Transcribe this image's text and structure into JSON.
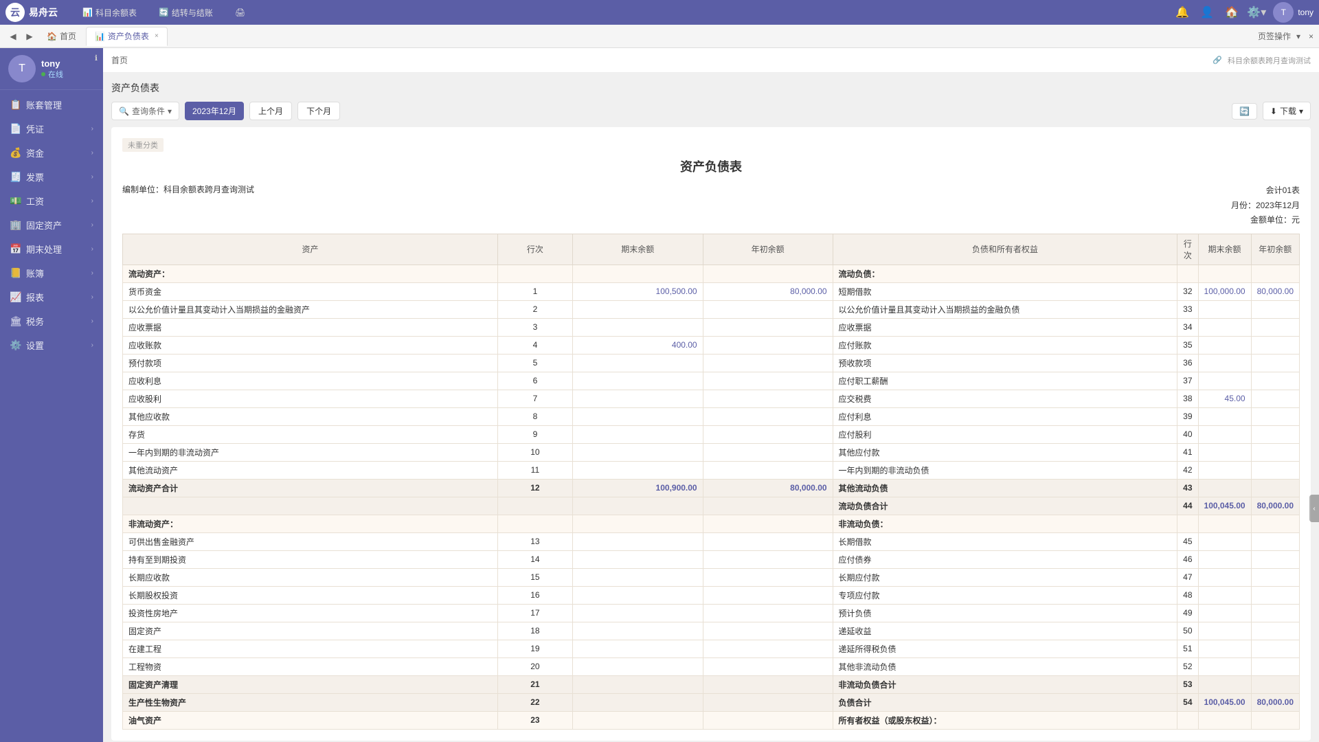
{
  "topbar": {
    "logo_text": "易舟云",
    "logo_icon": "云",
    "menus": [
      {
        "label": "科目余额表",
        "icon": "📊"
      },
      {
        "label": "结转与结账",
        "icon": "🔄"
      },
      {
        "label": "打印",
        "icon": "🖨"
      }
    ],
    "user": "tony",
    "icons": [
      "🔔",
      "👤",
      "🏠",
      "⚙️"
    ]
  },
  "tabs": {
    "home": "首页",
    "active_tab": "资产负债表",
    "tab_close": "×",
    "more_label": "页签操作",
    "close_all": "×"
  },
  "sidebar": {
    "user_name": "tony",
    "user_status": "在线",
    "items": [
      {
        "label": "账套管理",
        "icon": "📋",
        "has_arrow": false
      },
      {
        "label": "凭证",
        "icon": "📄",
        "has_arrow": true
      },
      {
        "label": "资金",
        "icon": "💰",
        "has_arrow": true
      },
      {
        "label": "发票",
        "icon": "🧾",
        "has_arrow": true
      },
      {
        "label": "工资",
        "icon": "💵",
        "has_arrow": true
      },
      {
        "label": "固定资产",
        "icon": "🏢",
        "has_arrow": true
      },
      {
        "label": "期末处理",
        "icon": "📅",
        "has_arrow": true
      },
      {
        "label": "账簿",
        "icon": "📒",
        "has_arrow": true
      },
      {
        "label": "报表",
        "icon": "📈",
        "has_arrow": true
      },
      {
        "label": "税务",
        "icon": "🏛",
        "has_arrow": true
      },
      {
        "label": "设置",
        "icon": "⚙️",
        "has_arrow": true
      }
    ]
  },
  "header": {
    "breadcrumb": [
      "首页",
      "资产负债表"
    ],
    "hint": "科目余额表跨月查询测试"
  },
  "page": {
    "title": "资产负债表",
    "filter_label": "查询条件",
    "current_month": "2023年12月",
    "prev_month": "上个月",
    "next_month": "下个月",
    "refresh_btn": "🔄",
    "download_btn": "下载"
  },
  "report": {
    "not_assigned_label": "未重分类",
    "title": "资产负债表",
    "prepared_by": "编制单位：科目余额表跨月查询测试",
    "month": "月份：2023年12月",
    "account_unit": "会计01表",
    "amount_unit": "金额单位：元",
    "columns": {
      "assets": "资产",
      "row_num": "行次",
      "end_balance": "期末余额",
      "year_begin": "年初余额",
      "liabilities": "负债和所有者权益",
      "row_num2": "行次",
      "end_balance2": "期末余额",
      "year_begin2": "年初余额"
    },
    "sections": [
      {
        "type": "section-header",
        "left_label": "流动资产：",
        "left_row": "",
        "left_end": "",
        "left_year": "",
        "right_label": "流动负债：",
        "right_row": "",
        "right_end": "",
        "right_year": ""
      },
      {
        "type": "subsection-header",
        "left_label": "流动资产：",
        "right_label": "流动负债："
      }
    ],
    "rows": [
      {
        "left_label": "货币资金",
        "left_row": "1",
        "left_end": "100,500.00",
        "left_year": "80,000.00",
        "right_label": "短期借款",
        "right_row": "32",
        "right_end": "100,000.00",
        "right_year": "80,000.00"
      },
      {
        "left_label": "以公允价值计量且其变动计入当期损益的金融资产",
        "left_row": "2",
        "left_end": "",
        "left_year": "",
        "right_label": "以公允价值计量且其变动计入当期损益的金融负债",
        "right_row": "33",
        "right_end": "",
        "right_year": ""
      },
      {
        "left_label": "应收票据",
        "left_row": "3",
        "left_end": "",
        "left_year": "",
        "right_label": "应收票据",
        "right_row": "34",
        "right_end": "",
        "right_year": ""
      },
      {
        "left_label": "应收账款",
        "left_row": "4",
        "left_end": "400.00",
        "left_year": "",
        "right_label": "应付账款",
        "right_row": "35",
        "right_end": "",
        "right_year": ""
      },
      {
        "left_label": "预付款项",
        "left_row": "5",
        "left_end": "",
        "left_year": "",
        "right_label": "预收款项",
        "right_row": "36",
        "right_end": "",
        "right_year": ""
      },
      {
        "left_label": "应收利息",
        "left_row": "6",
        "left_end": "",
        "left_year": "",
        "right_label": "应付职工薪酬",
        "right_row": "37",
        "right_end": "",
        "right_year": ""
      },
      {
        "left_label": "应收股利",
        "left_row": "7",
        "left_end": "",
        "left_year": "",
        "right_label": "应交税费",
        "right_row": "38",
        "right_end": "45.00",
        "right_year": ""
      },
      {
        "left_label": "其他应收款",
        "left_row": "8",
        "left_end": "",
        "left_year": "",
        "right_label": "应付利息",
        "right_row": "39",
        "right_end": "",
        "right_year": ""
      },
      {
        "left_label": "存货",
        "left_row": "9",
        "left_end": "",
        "left_year": "",
        "right_label": "应付股利",
        "right_row": "40",
        "right_end": "",
        "right_year": ""
      },
      {
        "left_label": "一年内到期的非流动资产",
        "left_row": "10",
        "left_end": "",
        "left_year": "",
        "right_label": "其他应付款",
        "right_row": "41",
        "right_end": "",
        "right_year": ""
      },
      {
        "left_label": "其他流动资产",
        "left_row": "11",
        "left_end": "",
        "left_year": "",
        "right_label": "一年内到期的非流动负债",
        "right_row": "42",
        "right_end": "",
        "right_year": ""
      },
      {
        "left_label": "流动资产合计",
        "left_row": "12",
        "left_end": "100,900.00",
        "left_year": "80,000.00",
        "right_label": "其他流动负债",
        "right_row": "43",
        "right_end": "",
        "right_year": "",
        "left_total": true
      },
      {
        "left_label": "",
        "left_row": "",
        "left_end": "",
        "left_year": "",
        "right_label": "流动负债合计",
        "right_row": "44",
        "right_end": "100,045.00",
        "right_year": "80,000.00",
        "right_total": true
      },
      {
        "left_label": "非流动资产：",
        "left_row": "",
        "left_end": "",
        "left_year": "",
        "right_label": "非流动负债：",
        "right_row": "",
        "right_end": "",
        "right_year": "",
        "left_section": true,
        "right_section": true
      },
      {
        "left_label": "可供出售金融资产",
        "left_row": "13",
        "left_end": "",
        "left_year": "",
        "right_label": "长期借款",
        "right_row": "45",
        "right_end": "",
        "right_year": ""
      },
      {
        "left_label": "持有至到期投资",
        "left_row": "14",
        "left_end": "",
        "left_year": "",
        "right_label": "应付债券",
        "right_row": "46",
        "right_end": "",
        "right_year": ""
      },
      {
        "left_label": "长期应收款",
        "left_row": "15",
        "left_end": "",
        "left_year": "",
        "right_label": "长期应付款",
        "right_row": "47",
        "right_end": "",
        "right_year": ""
      },
      {
        "left_label": "长期股权投资",
        "left_row": "16",
        "left_end": "",
        "left_year": "",
        "right_label": "专项应付款",
        "right_row": "48",
        "right_end": "",
        "right_year": ""
      },
      {
        "left_label": "投资性房地产",
        "left_row": "17",
        "left_end": "",
        "left_year": "",
        "right_label": "预计负债",
        "right_row": "49",
        "right_end": "",
        "right_year": ""
      },
      {
        "left_label": "固定资产",
        "left_row": "18",
        "left_end": "",
        "left_year": "",
        "right_label": "递延收益",
        "right_row": "50",
        "right_end": "",
        "right_year": ""
      },
      {
        "left_label": "在建工程",
        "left_row": "19",
        "left_end": "",
        "left_year": "",
        "right_label": "递延所得税负债",
        "right_row": "51",
        "right_end": "",
        "right_year": ""
      },
      {
        "left_label": "工程物资",
        "left_row": "20",
        "left_end": "",
        "left_year": "",
        "right_label": "其他非流动负债",
        "right_row": "52",
        "right_end": "",
        "right_year": ""
      },
      {
        "left_label": "固定资产清理",
        "left_row": "21",
        "left_end": "",
        "left_year": "",
        "right_label": "非流动负债合计",
        "right_row": "53",
        "right_end": "",
        "right_year": "",
        "right_total": true
      },
      {
        "left_label": "生产性生物资产",
        "left_row": "22",
        "left_end": "",
        "left_year": "",
        "right_label": "负债合计",
        "right_row": "54",
        "right_end": "100,045.00",
        "right_year": "80,000.00",
        "right_total": true
      },
      {
        "left_label": "油气资产",
        "left_row": "23",
        "left_end": "",
        "left_year": "",
        "right_label": "所有者权益（或股东权益）：",
        "right_row": "",
        "right_end": "",
        "right_year": "",
        "right_section": true
      }
    ]
  }
}
